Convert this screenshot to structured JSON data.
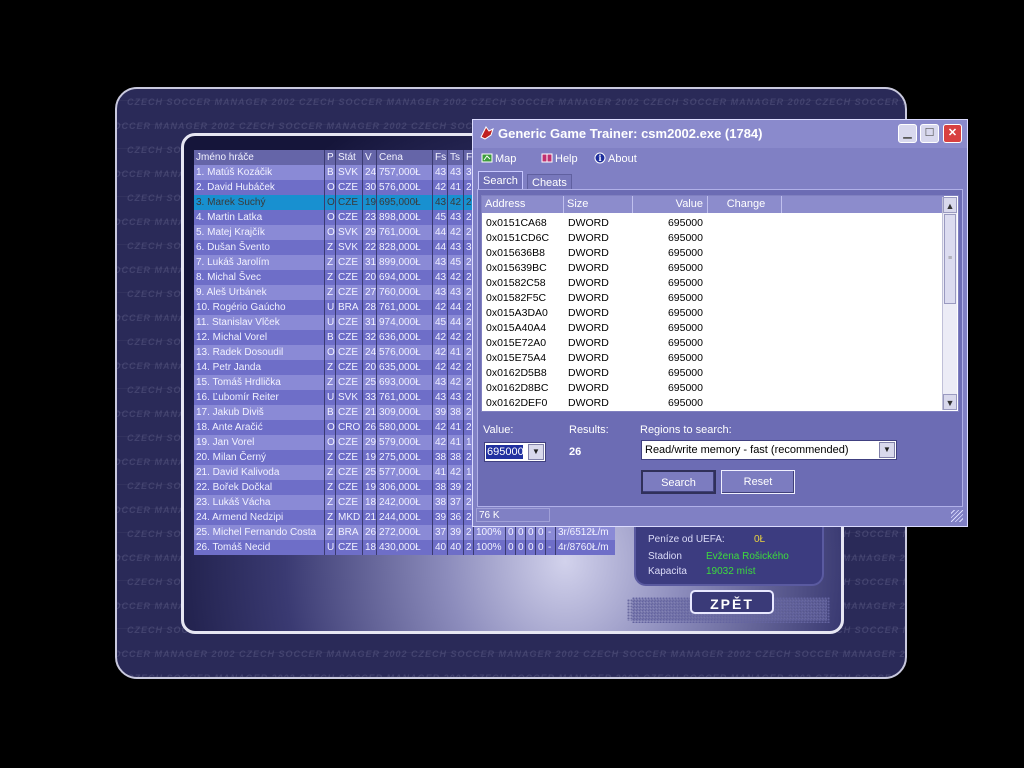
{
  "game": {
    "watermark": "CZECH SOCCER MANAGER 2002",
    "table_header": [
      "Jméno hráče",
      "P",
      "Stát",
      "V",
      "Cena",
      "Fs",
      "Ts",
      "F"
    ],
    "players": [
      {
        "name": "1. Matúš Kozáčik",
        "p": "B",
        "st": "SVK",
        "v": "24",
        "cena": "757,000Ł",
        "fs": "43",
        "ts": "43",
        "f": "3"
      },
      {
        "name": "2. David Hubáček",
        "p": "O",
        "st": "CZE",
        "v": "30",
        "cena": "576,000Ł",
        "fs": "42",
        "ts": "41",
        "f": "2"
      },
      {
        "name": "3. Marek Suchý",
        "p": "O",
        "st": "CZE",
        "v": "19",
        "cena": "695,000Ł",
        "fs": "43",
        "ts": "42",
        "f": "2",
        "selected": true
      },
      {
        "name": "4. Martin Latka",
        "p": "O",
        "st": "CZE",
        "v": "23",
        "cena": "898,000Ł",
        "fs": "45",
        "ts": "43",
        "f": "2"
      },
      {
        "name": "5. Matej Krajčík",
        "p": "O",
        "st": "SVK",
        "v": "29",
        "cena": "761,000Ł",
        "fs": "44",
        "ts": "42",
        "f": "2"
      },
      {
        "name": "6. Dušan Švento",
        "p": "Z",
        "st": "SVK",
        "v": "22",
        "cena": "828,000Ł",
        "fs": "44",
        "ts": "43",
        "f": "3"
      },
      {
        "name": "7. Lukáš Jarolím",
        "p": "Z",
        "st": "CZE",
        "v": "31",
        "cena": "899,000Ł",
        "fs": "43",
        "ts": "45",
        "f": "2"
      },
      {
        "name": "8. Michal Švec",
        "p": "Z",
        "st": "CZE",
        "v": "20",
        "cena": "694,000Ł",
        "fs": "43",
        "ts": "42",
        "f": "2"
      },
      {
        "name": "9. Aleš Urbánek",
        "p": "Z",
        "st": "CZE",
        "v": "27",
        "cena": "760,000Ł",
        "fs": "43",
        "ts": "43",
        "f": "2"
      },
      {
        "name": "10. Rogério Gaúcho",
        "p": "U",
        "st": "BRA",
        "v": "28",
        "cena": "761,000Ł",
        "fs": "42",
        "ts": "44",
        "f": "2"
      },
      {
        "name": "11. Stanislav Vlček",
        "p": "U",
        "st": "CZE",
        "v": "31",
        "cena": "974,000Ł",
        "fs": "45",
        "ts": "44",
        "f": "2"
      },
      {
        "name": "12. Michal Vorel",
        "p": "B",
        "st": "CZE",
        "v": "32",
        "cena": "636,000Ł",
        "fs": "42",
        "ts": "42",
        "f": "2"
      },
      {
        "name": "13. Radek Dosoudil",
        "p": "O",
        "st": "CZE",
        "v": "24",
        "cena": "576,000Ł",
        "fs": "42",
        "ts": "41",
        "f": "2"
      },
      {
        "name": "14. Petr Janda",
        "p": "Z",
        "st": "CZE",
        "v": "20",
        "cena": "635,000Ł",
        "fs": "42",
        "ts": "42",
        "f": "2"
      },
      {
        "name": "15. Tomáš Hrdlička",
        "p": "Z",
        "st": "CZE",
        "v": "25",
        "cena": "693,000Ł",
        "fs": "43",
        "ts": "42",
        "f": "2"
      },
      {
        "name": "16. Ľubomír Reiter",
        "p": "U",
        "st": "SVK",
        "v": "33",
        "cena": "761,000Ł",
        "fs": "43",
        "ts": "43",
        "f": "2"
      },
      {
        "name": "17. Jakub Diviš",
        "p": "B",
        "st": "CZE",
        "v": "21",
        "cena": "309,000Ł",
        "fs": "39",
        "ts": "38",
        "f": "2"
      },
      {
        "name": "18. Ante Aračić",
        "p": "O",
        "st": "CRO",
        "v": "26",
        "cena": "580,000Ł",
        "fs": "42",
        "ts": "41",
        "f": "2"
      },
      {
        "name": "19. Jan Vorel",
        "p": "O",
        "st": "CZE",
        "v": "29",
        "cena": "579,000Ł",
        "fs": "42",
        "ts": "41",
        "f": "1"
      },
      {
        "name": "20. Milan Černý",
        "p": "Z",
        "st": "CZE",
        "v": "19",
        "cena": "275,000Ł",
        "fs": "38",
        "ts": "38",
        "f": "2"
      },
      {
        "name": "21. David Kalivoda",
        "p": "Z",
        "st": "CZE",
        "v": "25",
        "cena": "577,000Ł",
        "fs": "41",
        "ts": "42",
        "f": "1"
      },
      {
        "name": "22. Bořek Dočkal",
        "p": "Z",
        "st": "CZE",
        "v": "19",
        "cena": "306,000Ł",
        "fs": "38",
        "ts": "39",
        "f": "2"
      },
      {
        "name": "23. Lukáš Vácha",
        "p": "Z",
        "st": "CZE",
        "v": "18",
        "cena": "242,000Ł",
        "fs": "38",
        "ts": "37",
        "f": "2"
      },
      {
        "name": "24. Armend Nedzipi",
        "p": "Z",
        "st": "MKD",
        "v": "21",
        "cena": "244,000Ł",
        "fs": "39",
        "ts": "36",
        "f": "2"
      },
      {
        "name": "25. Michel Fernando Costa",
        "p": "Z",
        "st": "BRA",
        "v": "26",
        "cena": "272,000Ł",
        "fs": "37",
        "ts": "39",
        "f": "2",
        "extra": [
          "100%",
          "0",
          "0",
          "0",
          "0",
          "-",
          "3r/6512Ł/m"
        ]
      },
      {
        "name": "26. Tomáš Necid",
        "p": "U",
        "st": "CZE",
        "v": "18",
        "cena": "430,000Ł",
        "fs": "40",
        "ts": "40",
        "f": "2",
        "extra": [
          "100%",
          "0",
          "0",
          "0",
          "0",
          "-",
          "4r/8760Ł/m"
        ]
      }
    ],
    "stadium": {
      "uefa_label": "Peníze od UEFA:",
      "uefa_value": "0Ł",
      "stadion_label": "Stadion",
      "stadion_value": "Evžena Rošického",
      "kapacita_label": "Kapacita",
      "kapacita_value": "19032 míst",
      "value_color": "#3cdc3c",
      "uefa_color": "#e8d040"
    },
    "back_button": "ZPĚT"
  },
  "trainer": {
    "title": "Generic Game Trainer: csm2002.exe (1784)",
    "menu": [
      {
        "label": "Map",
        "icon": "map-icon"
      },
      {
        "label": "Help",
        "icon": "help-book-icon"
      },
      {
        "label": "About",
        "icon": "info-icon"
      }
    ],
    "tabs": [
      "Search",
      "Cheats"
    ],
    "columns": [
      "Address",
      "Size",
      "Value",
      "Change"
    ],
    "rows": [
      {
        "address": "0x0151CA68",
        "size": "DWORD",
        "value": "695000"
      },
      {
        "address": "0x0151CD6C",
        "size": "DWORD",
        "value": "695000"
      },
      {
        "address": "0x015636B8",
        "size": "DWORD",
        "value": "695000"
      },
      {
        "address": "0x015639BC",
        "size": "DWORD",
        "value": "695000"
      },
      {
        "address": "0x01582C58",
        "size": "DWORD",
        "value": "695000"
      },
      {
        "address": "0x01582F5C",
        "size": "DWORD",
        "value": "695000"
      },
      {
        "address": "0x015A3DA0",
        "size": "DWORD",
        "value": "695000"
      },
      {
        "address": "0x015A40A4",
        "size": "DWORD",
        "value": "695000"
      },
      {
        "address": "0x015E72A0",
        "size": "DWORD",
        "value": "695000"
      },
      {
        "address": "0x015E75A4",
        "size": "DWORD",
        "value": "695000"
      },
      {
        "address": "0x0162D5B8",
        "size": "DWORD",
        "value": "695000"
      },
      {
        "address": "0x0162D8BC",
        "size": "DWORD",
        "value": "695000"
      },
      {
        "address": "0x0162DEF0",
        "size": "DWORD",
        "value": "695000"
      }
    ],
    "value_label": "Value:",
    "value_input": "695000",
    "results_label": "Results:",
    "results_count": "26",
    "regions_label": "Regions to search:",
    "regions_selected": "Read/write memory - fast (recommended)",
    "search_button": "Search",
    "reset_button": "Reset",
    "status_memory": "76 K"
  }
}
